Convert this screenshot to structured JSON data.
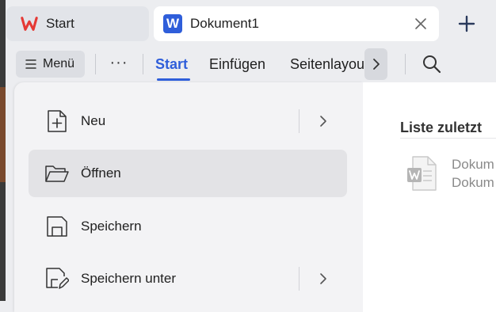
{
  "tabs": {
    "start": {
      "label": "Start",
      "icon": "wps-logo-icon"
    },
    "document": {
      "label": "Dokument1",
      "icon": "word-doc-icon",
      "icon_letter": "W"
    },
    "new_tab": {
      "icon": "plus-icon"
    }
  },
  "ribbon": {
    "menu_label": "Menü",
    "more_label": "···",
    "tabs": [
      {
        "label": "Start",
        "active": true
      },
      {
        "label": "Einfügen",
        "active": false
      },
      {
        "label": "Seitenlayout",
        "active": false
      }
    ]
  },
  "menu": {
    "items": [
      {
        "label": "Neu",
        "icon": "new-document-icon",
        "has_submenu": true
      },
      {
        "label": "Öffnen",
        "icon": "folder-open-icon",
        "has_submenu": false,
        "hovered": true
      },
      {
        "label": "Speichern",
        "icon": "save-icon",
        "has_submenu": false
      },
      {
        "label": "Speichern unter",
        "icon": "save-as-icon",
        "has_submenu": true
      }
    ]
  },
  "recent": {
    "title": "Liste zuletzt",
    "files": [
      {
        "name_line1": "Dokum",
        "name_line2": "Dokum",
        "icon": "word-file-icon"
      }
    ]
  },
  "colors": {
    "accent": "#2f5eda",
    "wps_red": "#e53935",
    "background": "#ecedf0"
  }
}
